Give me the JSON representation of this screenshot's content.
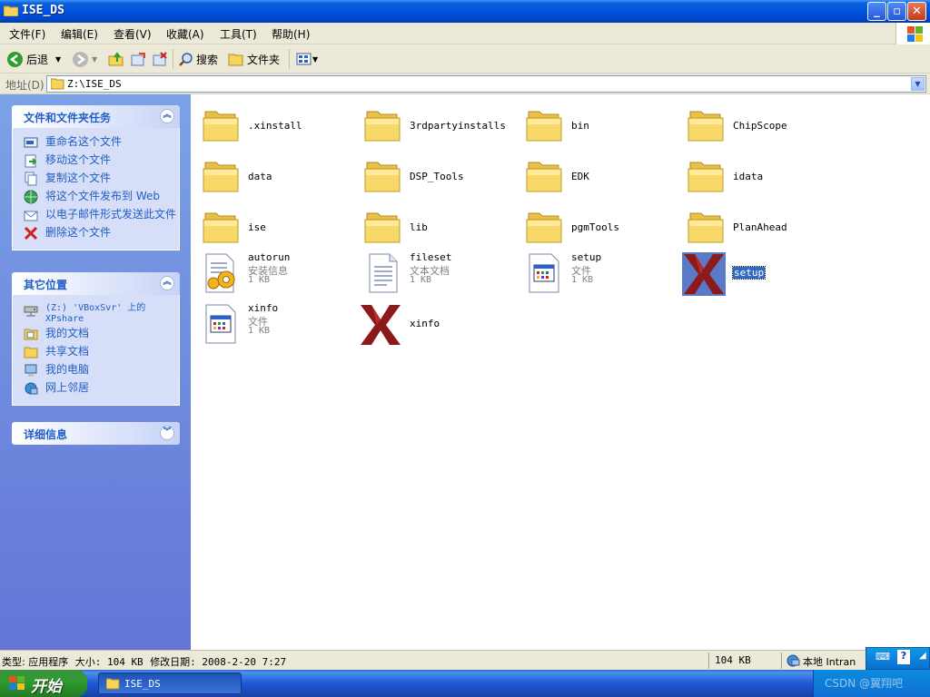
{
  "window": {
    "title": "ISE_DS"
  },
  "menu": [
    "文件(F)",
    "编辑(E)",
    "查看(V)",
    "收藏(A)",
    "工具(T)",
    "帮助(H)"
  ],
  "toolbar": {
    "back": "后退",
    "search": "搜索",
    "folders": "文件夹"
  },
  "address": {
    "label": "地址(D)",
    "value": "Z:\\ISE_DS"
  },
  "left_panels": {
    "tasks": {
      "title": "文件和文件夹任务",
      "items": [
        "重命名这个文件",
        "移动这个文件",
        "复制这个文件",
        "将这个文件发布到 Web",
        "以电子邮件形式发送此文件",
        "删除这个文件"
      ]
    },
    "places": {
      "title": "其它位置",
      "items": [
        "(Z:) 'VBoxSvr' 上的 XPshare",
        "我的文档",
        "共享文档",
        "我的电脑",
        "网上邻居"
      ]
    },
    "details": {
      "title": "详细信息"
    }
  },
  "files": [
    {
      "name": ".xinstall",
      "type": "folder"
    },
    {
      "name": "3rdpartyinstalls",
      "type": "folder"
    },
    {
      "name": "bin",
      "type": "folder"
    },
    {
      "name": "ChipScope",
      "type": "folder"
    },
    {
      "name": "data",
      "type": "folder"
    },
    {
      "name": "DSP_Tools",
      "type": "folder"
    },
    {
      "name": "EDK",
      "type": "folder"
    },
    {
      "name": "idata",
      "type": "folder"
    },
    {
      "name": "ise",
      "type": "folder"
    },
    {
      "name": "lib",
      "type": "folder"
    },
    {
      "name": "pgmTools",
      "type": "folder"
    },
    {
      "name": "PlanAhead",
      "type": "folder"
    },
    {
      "name": "autorun",
      "type": "setup-info",
      "desc": "安装信息",
      "size": "1 KB"
    },
    {
      "name": "fileset",
      "type": "text",
      "desc": "文本文档",
      "size": "1 KB"
    },
    {
      "name": "setup",
      "type": "file",
      "desc": "文件",
      "size": "1 KB"
    },
    {
      "name": "setup",
      "type": "exe",
      "selected": true
    },
    {
      "name": "xinfo",
      "type": "file",
      "desc": "文件",
      "size": "1 KB"
    },
    {
      "name": "xinfo",
      "type": "exe"
    }
  ],
  "status": {
    "type_label": "类型: 应用程序",
    "size_label": "大小: 104 KB",
    "date_label": "修改日期: 2008-2-20 7:27",
    "size": "104 KB",
    "zone": "本地 Intran"
  },
  "taskbar": {
    "start": "开始",
    "task": "ISE_DS",
    "watermark": "CSDN @翼翔吧"
  },
  "colors": {
    "titlebar": "#0054e3",
    "leftpane": "#7ba2e7",
    "link": "#215dc6",
    "selection": "#316ac5",
    "xilinx": "#8b1a1a"
  }
}
